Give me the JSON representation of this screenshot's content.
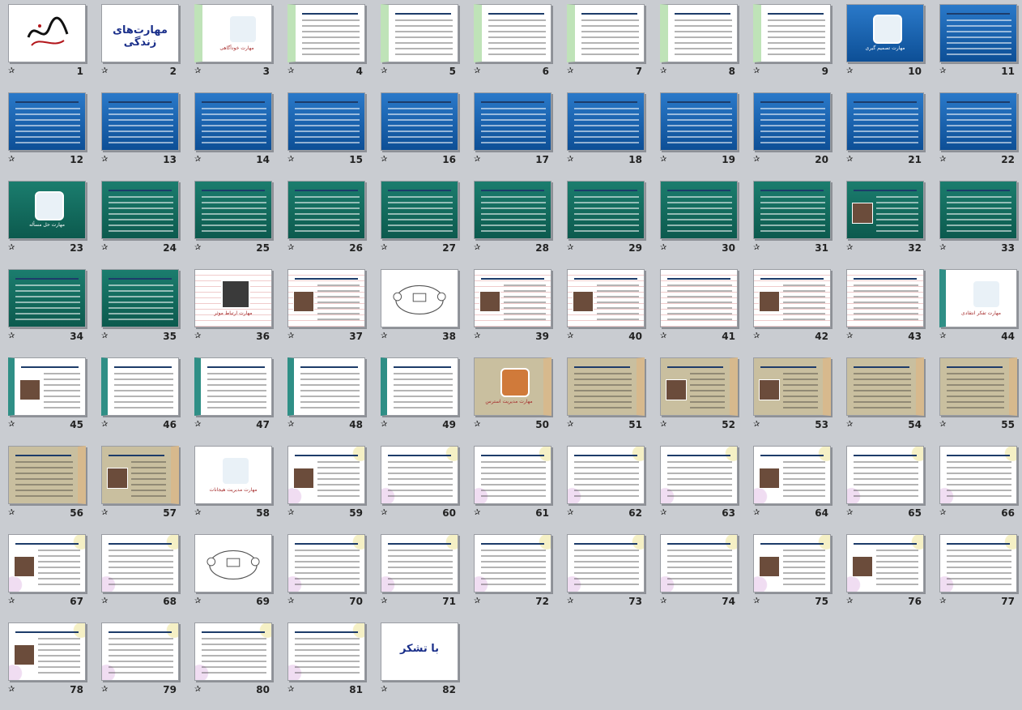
{
  "view": "slide-sorter",
  "theme_colors": {
    "blue": "#1659a8",
    "teal": "#10685b",
    "khaki": "#c9bf9f",
    "red_lines": "#f0cccc"
  },
  "slides": [
    {
      "n": "1",
      "theme": "w",
      "kind": "logo"
    },
    {
      "n": "2",
      "theme": "w",
      "kind": "title",
      "title": "مهارت‌های زندگی"
    },
    {
      "n": "3",
      "theme": "g",
      "kind": "section",
      "caption": "مهارت خودآگاهی"
    },
    {
      "n": "4",
      "theme": "g",
      "kind": "text"
    },
    {
      "n": "5",
      "theme": "g",
      "kind": "text"
    },
    {
      "n": "6",
      "theme": "g",
      "kind": "text"
    },
    {
      "n": "7",
      "theme": "g",
      "kind": "text"
    },
    {
      "n": "8",
      "theme": "g",
      "kind": "text"
    },
    {
      "n": "9",
      "theme": "g",
      "kind": "text"
    },
    {
      "n": "10",
      "theme": "b",
      "kind": "section",
      "caption": "مهارت تصمیم گیری"
    },
    {
      "n": "11",
      "theme": "b",
      "kind": "text"
    },
    {
      "n": "12",
      "theme": "b",
      "kind": "text"
    },
    {
      "n": "13",
      "theme": "b",
      "kind": "text"
    },
    {
      "n": "14",
      "theme": "b",
      "kind": "text"
    },
    {
      "n": "15",
      "theme": "b",
      "kind": "text"
    },
    {
      "n": "16",
      "theme": "b",
      "kind": "text"
    },
    {
      "n": "17",
      "theme": "b",
      "kind": "text"
    },
    {
      "n": "18",
      "theme": "b",
      "kind": "text"
    },
    {
      "n": "19",
      "theme": "b",
      "kind": "text"
    },
    {
      "n": "20",
      "theme": "b",
      "kind": "text"
    },
    {
      "n": "21",
      "theme": "b",
      "kind": "text"
    },
    {
      "n": "22",
      "theme": "b",
      "kind": "text"
    },
    {
      "n": "23",
      "theme": "t",
      "kind": "section",
      "caption": "مهارت حل مسأله"
    },
    {
      "n": "24",
      "theme": "t",
      "kind": "text"
    },
    {
      "n": "25",
      "theme": "t",
      "kind": "text"
    },
    {
      "n": "26",
      "theme": "t",
      "kind": "text"
    },
    {
      "n": "27",
      "theme": "t",
      "kind": "text"
    },
    {
      "n": "28",
      "theme": "t",
      "kind": "text"
    },
    {
      "n": "29",
      "theme": "t",
      "kind": "text"
    },
    {
      "n": "30",
      "theme": "t",
      "kind": "text"
    },
    {
      "n": "31",
      "theme": "t",
      "kind": "text"
    },
    {
      "n": "32",
      "theme": "t",
      "kind": "text-pic"
    },
    {
      "n": "33",
      "theme": "t",
      "kind": "text"
    },
    {
      "n": "34",
      "theme": "t",
      "kind": "text"
    },
    {
      "n": "35",
      "theme": "t",
      "kind": "text"
    },
    {
      "n": "36",
      "theme": "r",
      "kind": "section",
      "caption": "مهارت ارتباط موثر"
    },
    {
      "n": "37",
      "theme": "r",
      "kind": "text-pic"
    },
    {
      "n": "38",
      "theme": "w",
      "kind": "diagram"
    },
    {
      "n": "39",
      "theme": "r",
      "kind": "text-pic"
    },
    {
      "n": "40",
      "theme": "r",
      "kind": "text-pic"
    },
    {
      "n": "41",
      "theme": "r",
      "kind": "text"
    },
    {
      "n": "42",
      "theme": "r",
      "kind": "text-pic"
    },
    {
      "n": "43",
      "theme": "r",
      "kind": "text"
    },
    {
      "n": "44",
      "theme": "c",
      "kind": "section",
      "caption": "مهارت تفکر انتقادی"
    },
    {
      "n": "45",
      "theme": "c",
      "kind": "text-pic"
    },
    {
      "n": "46",
      "theme": "c",
      "kind": "text"
    },
    {
      "n": "47",
      "theme": "c",
      "kind": "text"
    },
    {
      "n": "48",
      "theme": "c",
      "kind": "text"
    },
    {
      "n": "49",
      "theme": "c",
      "kind": "text"
    },
    {
      "n": "50",
      "theme": "k",
      "kind": "section",
      "caption": "مهارت مدیریت استرس"
    },
    {
      "n": "51",
      "theme": "k",
      "kind": "text"
    },
    {
      "n": "52",
      "theme": "k",
      "kind": "text-pic"
    },
    {
      "n": "53",
      "theme": "k",
      "kind": "text-pic"
    },
    {
      "n": "54",
      "theme": "k",
      "kind": "text"
    },
    {
      "n": "55",
      "theme": "k",
      "kind": "text"
    },
    {
      "n": "56",
      "theme": "k",
      "kind": "text"
    },
    {
      "n": "57",
      "theme": "k",
      "kind": "text-pic"
    },
    {
      "n": "58",
      "theme": "w",
      "kind": "section",
      "caption": "مهارت مدیریت هیجانات"
    },
    {
      "n": "59",
      "theme": "l",
      "kind": "text-pic"
    },
    {
      "n": "60",
      "theme": "l",
      "kind": "text"
    },
    {
      "n": "61",
      "theme": "l",
      "kind": "text"
    },
    {
      "n": "62",
      "theme": "l",
      "kind": "text"
    },
    {
      "n": "63",
      "theme": "l",
      "kind": "text"
    },
    {
      "n": "64",
      "theme": "l",
      "kind": "text-pic"
    },
    {
      "n": "65",
      "theme": "l",
      "kind": "text"
    },
    {
      "n": "66",
      "theme": "l",
      "kind": "text"
    },
    {
      "n": "67",
      "theme": "l",
      "kind": "text-pic"
    },
    {
      "n": "68",
      "theme": "l",
      "kind": "text"
    },
    {
      "n": "69",
      "theme": "w",
      "kind": "diagram"
    },
    {
      "n": "70",
      "theme": "l",
      "kind": "text"
    },
    {
      "n": "71",
      "theme": "l",
      "kind": "text"
    },
    {
      "n": "72",
      "theme": "l",
      "kind": "text"
    },
    {
      "n": "73",
      "theme": "l",
      "kind": "text"
    },
    {
      "n": "74",
      "theme": "l",
      "kind": "text"
    },
    {
      "n": "75",
      "theme": "l",
      "kind": "text-pic"
    },
    {
      "n": "76",
      "theme": "l",
      "kind": "text-pic"
    },
    {
      "n": "77",
      "theme": "l",
      "kind": "text"
    },
    {
      "n": "78",
      "theme": "l",
      "kind": "text-pic"
    },
    {
      "n": "79",
      "theme": "l",
      "kind": "text"
    },
    {
      "n": "80",
      "theme": "l",
      "kind": "text"
    },
    {
      "n": "81",
      "theme": "l",
      "kind": "text"
    },
    {
      "n": "82",
      "theme": "w",
      "kind": "title",
      "title": "با تشکر"
    }
  ],
  "star_icon": "star-icon",
  "star_glyph": "✰"
}
